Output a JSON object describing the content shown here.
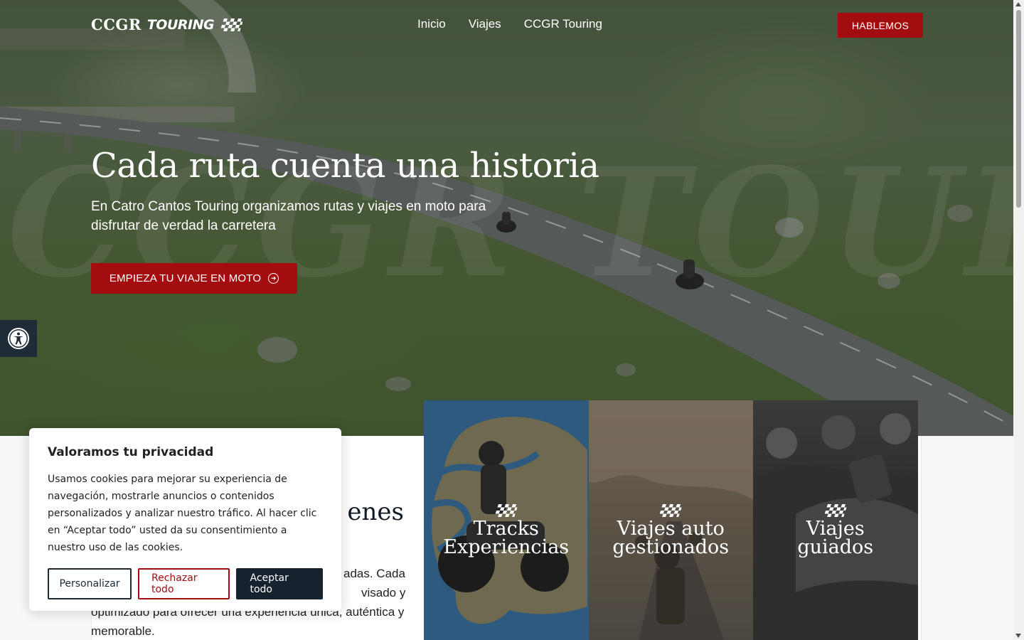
{
  "header": {
    "logo_main": "CCGR",
    "logo_sub": "TOURING",
    "nav": [
      "Inicio",
      "Viajes",
      "CCGR Touring"
    ],
    "cta_label": "HABLEMOS"
  },
  "hero": {
    "watermark": "CCGR TOURING",
    "title": "Cada ruta cuenta una historia",
    "subtitle": "En Catro Cantos Touring organizamos rutas y viajes en moto para disfrutar de verdad la carretera",
    "cta_label": "EMPIEZA TU VIAJE EN MOTO"
  },
  "intro": {
    "heading_visible": "enes",
    "text_visible": "adas. Cada / visado y / optimizado para ofrecer una experiencia única, auténtica y / memorable.",
    "line1": "adas. Cada",
    "line2": "visado y",
    "line3": "optimizado para ofrecer una experiencia única, auténtica y",
    "line4": "memorable."
  },
  "cards": [
    {
      "line1": "Tracks",
      "line2": "Experiencias"
    },
    {
      "line1": "Viajes auto",
      "line2": "gestionados"
    },
    {
      "line1": "Viajes",
      "line2": "guiados"
    }
  ],
  "cookie": {
    "title": "Valoramos tu privacidad",
    "text": "Usamos cookies para mejorar su experiencia de navegación, mostrarle anuncios o contenidos personalizados y analizar nuestro tráfico. Al hacer clic en “Aceptar todo” usted da su consentimiento a nuestro uso de las cookies.",
    "btn_customize": "Personalizar",
    "btn_reject": "Rechazar todo",
    "btn_accept": "Aceptar todo"
  },
  "colors": {
    "brand_red": "#a30d0f",
    "dark_navy": "#16232f",
    "card_blue": "#2d5a7e"
  },
  "icons": [
    "checkered-flag-icon",
    "arrow-circle-right-icon",
    "accessibility-icon"
  ]
}
